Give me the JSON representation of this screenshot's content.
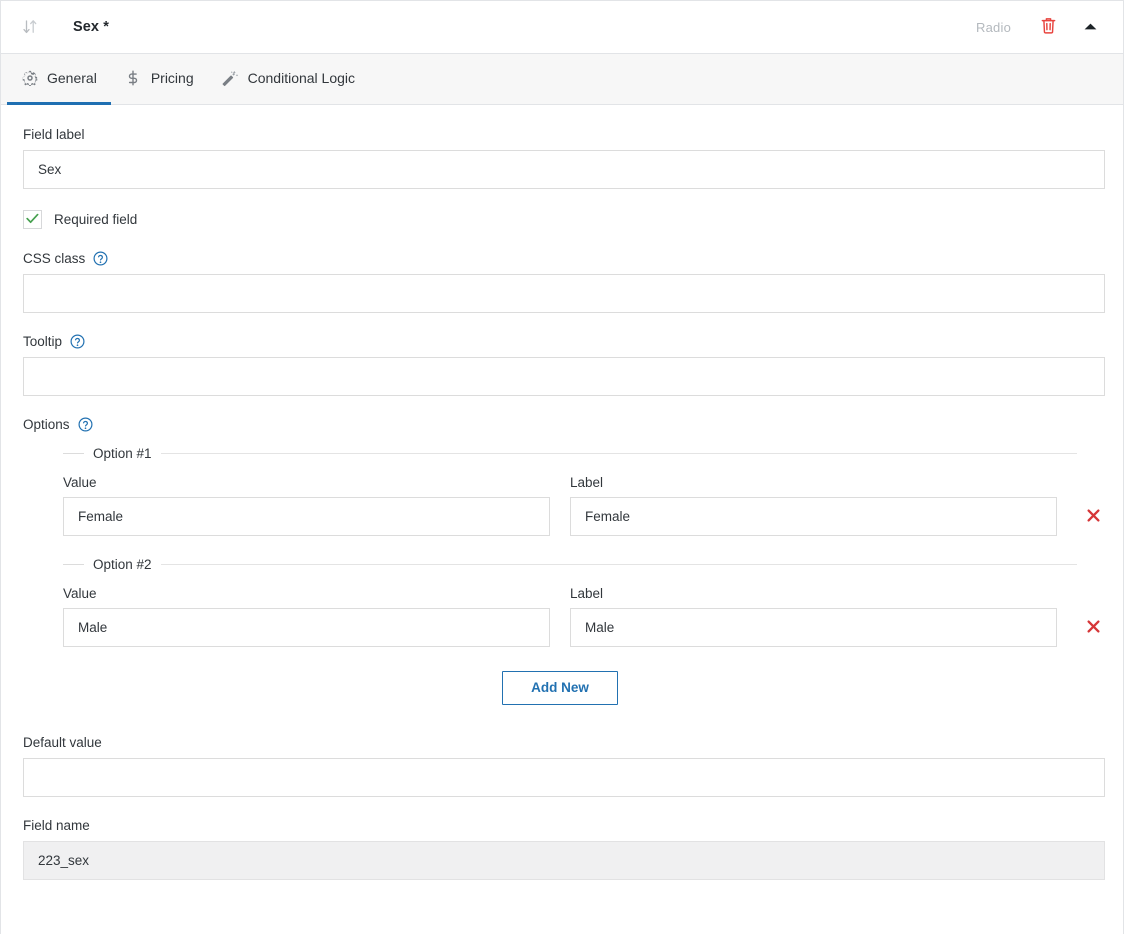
{
  "header": {
    "drag_icon": "sort-updown-icon",
    "title": "Sex *",
    "field_type": "Radio",
    "delete_icon": "trash-icon",
    "collapse_icon": "caret-up-icon"
  },
  "tabs": [
    {
      "label": "General",
      "icon": "gear-icon",
      "active": true
    },
    {
      "label": "Pricing",
      "icon": "dollar-icon",
      "active": false
    },
    {
      "label": "Conditional Logic",
      "icon": "magic-wand-icon",
      "active": false
    }
  ],
  "general": {
    "field_label": {
      "label": "Field label",
      "value": "Sex",
      "placeholder": ""
    },
    "required": {
      "label": "Required field",
      "checked": true,
      "check_icon": "check-icon",
      "check_color": "#46a04f"
    },
    "css_class": {
      "label": "CSS class",
      "help_icon": "question-circle-icon",
      "value": "",
      "placeholder": ""
    },
    "tooltip": {
      "label": "Tooltip",
      "help_icon": "question-circle-icon",
      "value": "",
      "placeholder": ""
    },
    "options": {
      "label": "Options",
      "help_icon": "question-circle-icon",
      "value_label": "Value",
      "label_label": "Label",
      "remove_icon": "x-icon",
      "items": [
        {
          "legend": "Option #1",
          "value": "Female",
          "label": "Female"
        },
        {
          "legend": "Option #2",
          "value": "Male",
          "label": "Male"
        }
      ],
      "add_new_label": "Add New"
    },
    "default_value": {
      "label": "Default value",
      "value": "",
      "placeholder": ""
    },
    "field_name": {
      "label": "Field name",
      "value": "223_sex",
      "readonly": true
    }
  },
  "colors": {
    "accent": "#2271b1",
    "active_tab_underline": "#1f6fb2",
    "danger": "#d63638",
    "success": "#46a04f",
    "muted_text": "#b4b9be",
    "border": "#dcdcdc",
    "panel_border": "#e2e4e7",
    "tabbar_bg": "#f7f7f7",
    "readonly_bg": "#f0f0f1"
  }
}
